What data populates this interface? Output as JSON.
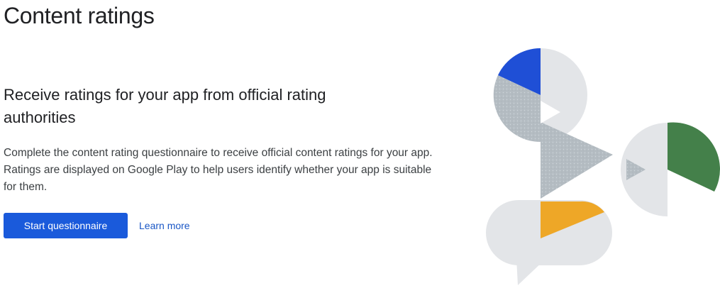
{
  "page": {
    "title": "Content ratings"
  },
  "main": {
    "headline": "Receive ratings for your app from official rating authorities",
    "description": "Complete the content rating questionnaire to receive official content ratings for your app. Ratings are displayed on Google Play to help users identify whether your app is suitable for them.",
    "primary_button_label": "Start questionnaire",
    "secondary_link_label": "Learn more"
  },
  "illustration": {
    "name": "content-ratings-illustration",
    "colors": {
      "blue": "#1f4fd6",
      "green": "#44804a",
      "yellow": "#eea727",
      "gray_light": "#e3e5e8",
      "gray_dotted": "#b4bcc2"
    }
  },
  "colors": {
    "primary": "#1a5adb",
    "link": "#1a57c6",
    "text": "#202124"
  }
}
